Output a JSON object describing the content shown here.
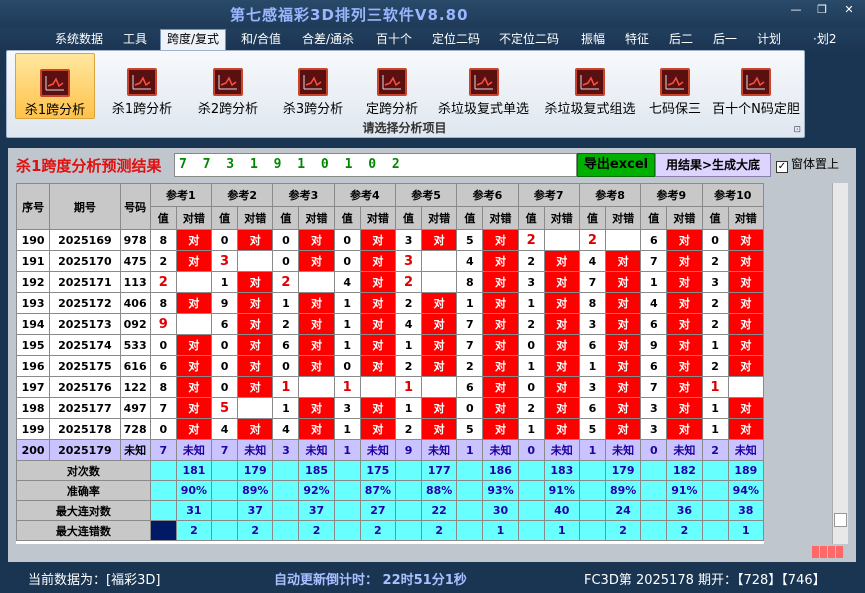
{
  "app": {
    "title": "第七感福彩3D排列三软件V8.80",
    "win_min": "—",
    "win_max": "❐",
    "win_close": "✕"
  },
  "menu": [
    "系统数据",
    "工具",
    "跨度/复式",
    "和/合值",
    "合差/通杀",
    "百十个",
    "定位二码",
    "不定位二码",
    "振幅",
    "特征",
    "后二",
    "后一",
    "计划",
    "·划2"
  ],
  "menu_active": 2,
  "ribbon": {
    "buttons": [
      "杀1跨分析",
      "杀1跨分析",
      "杀2跨分析",
      "杀3跨分析",
      "定跨分析",
      "杀垃圾复式单选",
      "杀垃圾复式组选",
      "七码保三",
      "百十个N码定胆"
    ],
    "selected": 0,
    "caption": "请选择分析项目",
    "corner": "⊡"
  },
  "result": {
    "title": "杀1跨度分析预测结果",
    "value": "7 7 3 1 9 1 0 1 0 2",
    "export_label": "导出excel",
    "generate_label": "用结果>生成大底",
    "topmost_label": "窗体置上",
    "topmost_checked": "✓"
  },
  "table": {
    "col_seq": "序号",
    "col_issue": "期号",
    "col_code": "号码",
    "refs": [
      "参考1",
      "参考2",
      "参考3",
      "参考4",
      "参考5",
      "参考6",
      "参考7",
      "参考8",
      "参考9",
      "参考10"
    ],
    "sub_val": "值",
    "sub_hit": "对错",
    "rows": [
      {
        "seq": "190",
        "issue": "2025169",
        "code": "978",
        "cells": [
          [
            "8",
            "对"
          ],
          [
            "0",
            "对"
          ],
          [
            "0",
            "对"
          ],
          [
            "0",
            "对"
          ],
          [
            "3",
            "对"
          ],
          [
            "5",
            "对"
          ],
          [
            "2",
            ""
          ],
          [
            "2",
            ""
          ],
          [
            "6",
            "对"
          ],
          [
            "0",
            "对"
          ]
        ]
      },
      {
        "seq": "191",
        "issue": "2025170",
        "code": "475",
        "cells": [
          [
            "2",
            "对"
          ],
          [
            "3",
            ""
          ],
          [
            "0",
            "对"
          ],
          [
            "0",
            "对"
          ],
          [
            "3",
            ""
          ],
          [
            "4",
            "对"
          ],
          [
            "2",
            "对"
          ],
          [
            "4",
            "对"
          ],
          [
            "7",
            "对"
          ],
          [
            "2",
            "对"
          ]
        ]
      },
      {
        "seq": "192",
        "issue": "2025171",
        "code": "113",
        "cells": [
          [
            "2",
            ""
          ],
          [
            "1",
            "对"
          ],
          [
            "2",
            ""
          ],
          [
            "4",
            "对"
          ],
          [
            "2",
            ""
          ],
          [
            "8",
            "对"
          ],
          [
            "3",
            "对"
          ],
          [
            "7",
            "对"
          ],
          [
            "1",
            "对"
          ],
          [
            "3",
            "对"
          ]
        ]
      },
      {
        "seq": "193",
        "issue": "2025172",
        "code": "406",
        "cells": [
          [
            "8",
            "对"
          ],
          [
            "9",
            "对"
          ],
          [
            "1",
            "对"
          ],
          [
            "1",
            "对"
          ],
          [
            "2",
            "对"
          ],
          [
            "1",
            "对"
          ],
          [
            "1",
            "对"
          ],
          [
            "8",
            "对"
          ],
          [
            "4",
            "对"
          ],
          [
            "2",
            "对"
          ]
        ]
      },
      {
        "seq": "194",
        "issue": "2025173",
        "code": "092",
        "cells": [
          [
            "9",
            ""
          ],
          [
            "6",
            "对"
          ],
          [
            "2",
            "对"
          ],
          [
            "1",
            "对"
          ],
          [
            "4",
            "对"
          ],
          [
            "7",
            "对"
          ],
          [
            "2",
            "对"
          ],
          [
            "3",
            "对"
          ],
          [
            "6",
            "对"
          ],
          [
            "2",
            "对"
          ]
        ]
      },
      {
        "seq": "195",
        "issue": "2025174",
        "code": "533",
        "cells": [
          [
            "0",
            "对"
          ],
          [
            "0",
            "对"
          ],
          [
            "6",
            "对"
          ],
          [
            "1",
            "对"
          ],
          [
            "1",
            "对"
          ],
          [
            "7",
            "对"
          ],
          [
            "0",
            "对"
          ],
          [
            "6",
            "对"
          ],
          [
            "9",
            "对"
          ],
          [
            "1",
            "对"
          ]
        ]
      },
      {
        "seq": "196",
        "issue": "2025175",
        "code": "616",
        "cells": [
          [
            "6",
            "对"
          ],
          [
            "0",
            "对"
          ],
          [
            "0",
            "对"
          ],
          [
            "0",
            "对"
          ],
          [
            "2",
            "对"
          ],
          [
            "2",
            "对"
          ],
          [
            "1",
            "对"
          ],
          [
            "1",
            "对"
          ],
          [
            "6",
            "对"
          ],
          [
            "2",
            "对"
          ]
        ]
      },
      {
        "seq": "197",
        "issue": "2025176",
        "code": "122",
        "cells": [
          [
            "8",
            "对"
          ],
          [
            "0",
            "对"
          ],
          [
            "1",
            ""
          ],
          [
            "1",
            ""
          ],
          [
            "1",
            ""
          ],
          [
            "6",
            "对"
          ],
          [
            "0",
            "对"
          ],
          [
            "3",
            "对"
          ],
          [
            "7",
            "对"
          ],
          [
            "1",
            ""
          ]
        ]
      },
      {
        "seq": "198",
        "issue": "2025177",
        "code": "497",
        "cells": [
          [
            "7",
            "对"
          ],
          [
            "5",
            ""
          ],
          [
            "1",
            "对"
          ],
          [
            "3",
            "对"
          ],
          [
            "1",
            "对"
          ],
          [
            "0",
            "对"
          ],
          [
            "2",
            "对"
          ],
          [
            "6",
            "对"
          ],
          [
            "3",
            "对"
          ],
          [
            "1",
            "对"
          ]
        ]
      },
      {
        "seq": "199",
        "issue": "2025178",
        "code": "728",
        "cells": [
          [
            "0",
            "对"
          ],
          [
            "4",
            "对"
          ],
          [
            "4",
            "对"
          ],
          [
            "1",
            "对"
          ],
          [
            "2",
            "对"
          ],
          [
            "5",
            "对"
          ],
          [
            "1",
            "对"
          ],
          [
            "5",
            "对"
          ],
          [
            "3",
            "对"
          ],
          [
            "1",
            "对"
          ]
        ]
      }
    ],
    "red_vals": [
      [
        0,
        6
      ],
      [
        0,
        7
      ],
      [
        1,
        1
      ],
      [
        1,
        4
      ],
      [
        2,
        0
      ],
      [
        2,
        2
      ],
      [
        2,
        4
      ],
      [
        4,
        0
      ],
      [
        7,
        2
      ],
      [
        7,
        3
      ],
      [
        7,
        4
      ],
      [
        7,
        9
      ],
      [
        8,
        1
      ]
    ],
    "unknown_row": {
      "seq": "200",
      "issue": "2025179",
      "code": "未知",
      "vals": [
        "7",
        "7",
        "3",
        "1",
        "9",
        "1",
        "0",
        "1",
        "0",
        "2"
      ],
      "label": "未知"
    },
    "stats": [
      {
        "label": "对次数",
        "vals": [
          "181",
          "179",
          "185",
          "175",
          "177",
          "186",
          "183",
          "179",
          "182",
          "189"
        ]
      },
      {
        "label": "准确率",
        "vals": [
          "90%",
          "89%",
          "92%",
          "87%",
          "88%",
          "93%",
          "91%",
          "89%",
          "91%",
          "94%"
        ]
      },
      {
        "label": "最大连对数",
        "vals": [
          "31",
          "37",
          "37",
          "27",
          "22",
          "30",
          "40",
          "24",
          "36",
          "38"
        ]
      },
      {
        "label": "最大连错数",
        "vals": [
          "2",
          "2",
          "2",
          "2",
          "2",
          "1",
          "1",
          "2",
          "2",
          "1"
        ]
      }
    ]
  },
  "colors": {
    "hit": "#ff0000",
    "unknown": "#c9c3ff",
    "stats": "#68ffff"
  },
  "status": {
    "left": "当前数据为：[福彩3D]",
    "countdown": "自动更新倒计时： 22时51分1秒",
    "right": "FC3D第 2025178 期开：【728】【746】"
  }
}
